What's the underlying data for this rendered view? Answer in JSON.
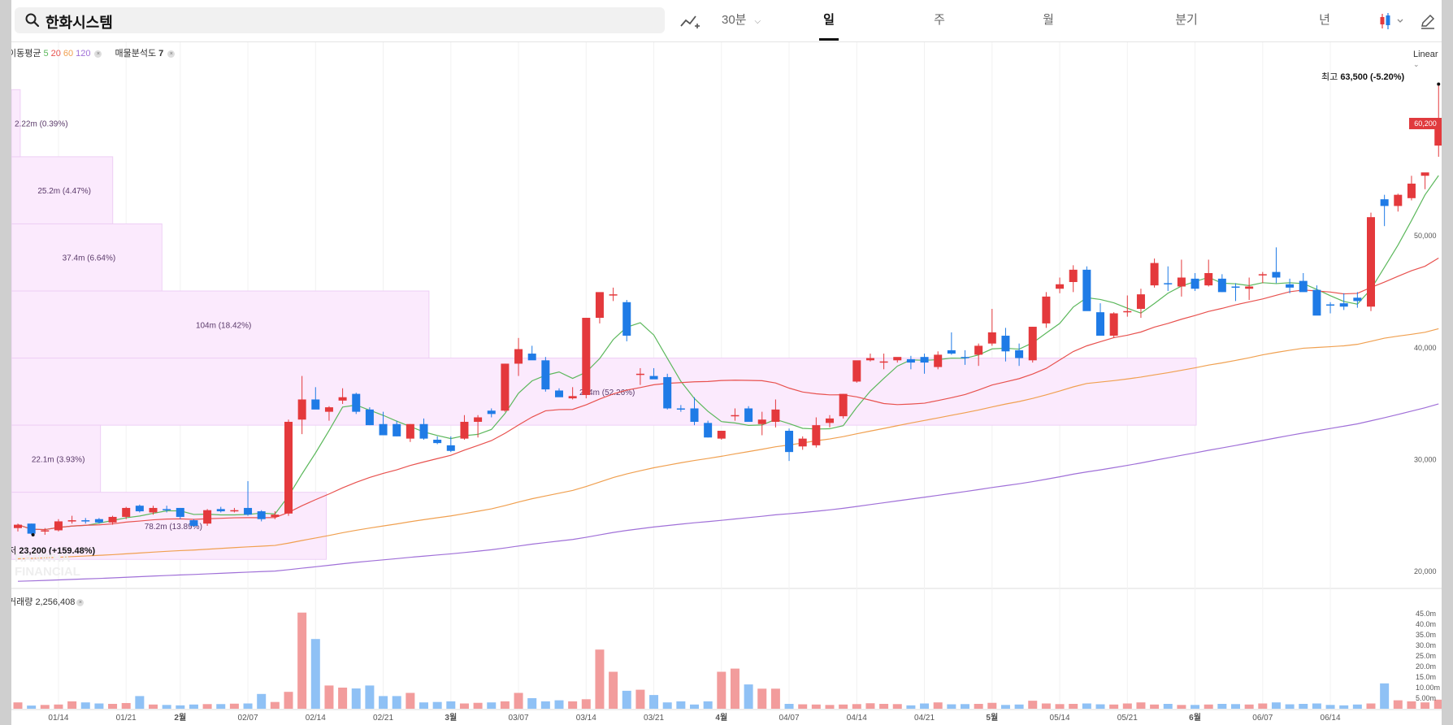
{
  "search": {
    "query": "한화시스템",
    "icon": "search-icon"
  },
  "toolbar": {
    "draw_icon": "draw-line-icon",
    "interval": "30분",
    "tabs": [
      {
        "label": "일",
        "active": true
      },
      {
        "label": "주",
        "active": false
      },
      {
        "label": "월",
        "active": false
      },
      {
        "label": "분기",
        "active": false
      },
      {
        "label": "년",
        "active": false
      }
    ],
    "chart_type_icon": "candlestick-icon",
    "pen_icon": "pencil-icon"
  },
  "legend": {
    "ma_label": "이동평균",
    "ma_periods": [
      "5",
      "20",
      "60",
      "120"
    ],
    "ma_colors": [
      "#5cb85c",
      "#e8524f",
      "#f0a050",
      "#a070d8"
    ],
    "profile_label": "매물분석도",
    "profile_count": "7"
  },
  "scale_label": "Linear",
  "current_price_tag": "60,200",
  "high": {
    "prefix": "최고",
    "value": "63,500",
    "change": "(-5.20%)"
  },
  "low": {
    "prefix": "최저",
    "value": "23,200",
    "change": "(+159.48%)"
  },
  "watermark": [
    "HANWHA",
    "FINANCIAL"
  ],
  "volume_legend": {
    "label": "거래량",
    "value": "2,256,408"
  },
  "colors": {
    "up": "#e4393c",
    "down": "#1f7be6",
    "up_vol": "#f29c9c",
    "down_vol": "#8fc1f5",
    "profile": "#fbeafd",
    "profile_border": "#eecff5"
  },
  "chart_data": {
    "type": "candlestick",
    "price_axis": {
      "ticks": [
        20000,
        30000,
        40000,
        50000
      ],
      "tick_labels": [
        "20,000",
        "30,000",
        "40,000",
        "50,000"
      ],
      "range": [
        17000,
        63500
      ]
    },
    "volume_axis": {
      "ticks": [
        5,
        10,
        15,
        20,
        25,
        30,
        35,
        40,
        45
      ],
      "tick_labels": [
        "5.00m",
        "10.00m",
        "15.0m",
        "20.0m",
        "25.0m",
        "30.0m",
        "35.0m",
        "40.0m",
        "45.0m"
      ],
      "range": [
        0,
        47
      ]
    },
    "x_ticks": [
      "01/14",
      "01/21",
      "2월",
      "02/07",
      "02/14",
      "02/21",
      "3월",
      "03/07",
      "03/14",
      "03/21",
      "4월",
      "04/07",
      "04/14",
      "04/21",
      "5월",
      "05/14",
      "05/21",
      "6월",
      "06/07",
      "06/14"
    ],
    "x_tick_index": [
      3,
      8,
      12,
      17,
      22,
      27,
      32,
      37,
      42,
      47,
      52,
      57,
      62,
      67,
      72,
      77,
      82,
      87,
      92,
      97
    ],
    "volume_profile": [
      {
        "label": "294m (52.26%)",
        "low": 33000,
        "high": 39000,
        "pct": 52.26
      },
      {
        "label": "104m (18.42%)",
        "low": 39000,
        "high": 45000,
        "pct": 18.42
      },
      {
        "label": "37.4m (6.64%)",
        "low": 45000,
        "high": 51000,
        "pct": 6.64
      },
      {
        "label": "25.2m (4.47%)",
        "low": 51000,
        "high": 57000,
        "pct": 4.47
      },
      {
        "label": "2.22m (0.39%)",
        "low": 57000,
        "high": 63000,
        "pct": 0.39
      },
      {
        "label": "22.1m (3.93%)",
        "low": 27000,
        "high": 33000,
        "pct": 3.93
      },
      {
        "label": "78.2m (13.89%)",
        "low": 21000,
        "high": 27000,
        "pct": 13.89
      }
    ],
    "candles": [
      [
        23800,
        24200,
        23500,
        24100
      ],
      [
        24200,
        24200,
        23200,
        23300
      ],
      [
        23500,
        23800,
        23200,
        23600
      ],
      [
        23600,
        24600,
        23500,
        24400
      ],
      [
        24500,
        24900,
        24200,
        24500
      ],
      [
        24500,
        24700,
        24200,
        24400
      ],
      [
        24600,
        24700,
        24200,
        24300
      ],
      [
        24300,
        24900,
        24100,
        24800
      ],
      [
        24800,
        25700,
        24600,
        25600
      ],
      [
        25800,
        25900,
        25200,
        25300
      ],
      [
        25200,
        25800,
        25000,
        25600
      ],
      [
        25500,
        25800,
        25200,
        25400
      ],
      [
        25600,
        25600,
        24600,
        24800
      ],
      [
        24500,
        24600,
        23900,
        24000
      ],
      [
        24200,
        25500,
        24000,
        25400
      ],
      [
        25500,
        25700,
        25200,
        25300
      ],
      [
        25400,
        25600,
        25200,
        25400
      ],
      [
        25600,
        28000,
        24900,
        25000
      ],
      [
        25300,
        25400,
        24400,
        24600
      ],
      [
        24800,
        25300,
        24600,
        25000
      ],
      [
        25100,
        33500,
        24900,
        33300
      ],
      [
        33500,
        37400,
        32200,
        35300
      ],
      [
        35300,
        36400,
        34700,
        34400
      ],
      [
        34200,
        34700,
        33400,
        34600
      ],
      [
        35200,
        36300,
        34900,
        35500
      ],
      [
        35800,
        35900,
        34000,
        34200
      ],
      [
        34400,
        34600,
        33000,
        33000
      ],
      [
        33100,
        34200,
        32300,
        32100
      ],
      [
        33100,
        33400,
        32000,
        32000
      ],
      [
        31800,
        33100,
        31500,
        33100
      ],
      [
        33100,
        33600,
        31700,
        31800
      ],
      [
        31700,
        32000,
        31300,
        31400
      ],
      [
        31200,
        32000,
        30600,
        30700
      ],
      [
        31800,
        33900,
        31700,
        33300
      ],
      [
        33300,
        33900,
        31900,
        33700
      ],
      [
        34300,
        34500,
        33700,
        34000
      ],
      [
        34300,
        38500,
        34200,
        38500
      ],
      [
        38500,
        40800,
        37400,
        39800
      ],
      [
        39400,
        40100,
        38900,
        38800
      ],
      [
        38800,
        39100,
        36000,
        36200
      ],
      [
        36100,
        36300,
        35600,
        35500
      ],
      [
        35400,
        36400,
        35300,
        35600
      ],
      [
        35700,
        42600,
        35400,
        42600
      ],
      [
        42600,
        44800,
        42100,
        44900
      ],
      [
        44700,
        45300,
        44100,
        44700
      ],
      [
        44000,
        44200,
        40500,
        41000
      ],
      [
        37500,
        38100,
        36600,
        37600
      ],
      [
        37400,
        38100,
        37300,
        37100
      ],
      [
        37300,
        37600,
        34400,
        34500
      ],
      [
        34500,
        34800,
        34200,
        34400
      ],
      [
        34500,
        35500,
        33000,
        33300
      ],
      [
        33200,
        33400,
        31900,
        31900
      ],
      [
        31800,
        32200,
        31700,
        32500
      ],
      [
        33800,
        34500,
        33400,
        33900
      ],
      [
        34500,
        34700,
        33500,
        33300
      ],
      [
        33100,
        34200,
        32100,
        33500
      ],
      [
        33300,
        35300,
        32800,
        34400
      ],
      [
        32500,
        32700,
        29800,
        30600
      ],
      [
        31100,
        32000,
        30800,
        31800
      ],
      [
        31200,
        33700,
        31000,
        33000
      ],
      [
        33200,
        33900,
        32800,
        33600
      ],
      [
        33800,
        35800,
        33600,
        35800
      ],
      [
        36900,
        38700,
        36800,
        38800
      ],
      [
        38800,
        39400,
        38700,
        39000
      ],
      [
        38700,
        39400,
        38000,
        38700
      ],
      [
        38800,
        39000,
        38600,
        39100
      ],
      [
        38900,
        39200,
        38000,
        38600
      ],
      [
        39100,
        39400,
        37600,
        38600
      ],
      [
        38200,
        39600,
        38000,
        39300
      ],
      [
        39700,
        41300,
        39300,
        39400
      ],
      [
        39100,
        39700,
        38400,
        39000
      ],
      [
        39300,
        40300,
        38300,
        40100
      ],
      [
        40300,
        43400,
        40100,
        41300
      ],
      [
        41000,
        41700,
        38700,
        39600
      ],
      [
        39700,
        40300,
        38300,
        39000
      ],
      [
        38800,
        41800,
        38600,
        41800
      ],
      [
        42100,
        44900,
        41700,
        44500
      ],
      [
        45200,
        46200,
        44800,
        45600
      ],
      [
        45800,
        47300,
        44900,
        46900
      ],
      [
        46900,
        47200,
        43300,
        43200
      ],
      [
        43100,
        43900,
        42700,
        41000
      ],
      [
        41000,
        43100,
        40800,
        43000
      ],
      [
        43100,
        44600,
        42700,
        43200
      ],
      [
        43400,
        45200,
        42600,
        44700
      ],
      [
        45500,
        47900,
        45300,
        47500
      ],
      [
        45700,
        47200,
        45000,
        45600
      ],
      [
        45400,
        47800,
        44500,
        46200
      ],
      [
        46100,
        46600,
        45000,
        45200
      ],
      [
        45500,
        47800,
        45400,
        46600
      ],
      [
        46100,
        46500,
        44900,
        44900
      ],
      [
        45400,
        45700,
        44100,
        45300
      ],
      [
        45200,
        46200,
        44200,
        45400
      ],
      [
        46400,
        46700,
        45700,
        46500
      ],
      [
        46700,
        48900,
        45700,
        46200
      ],
      [
        45600,
        46100,
        44800,
        45300
      ],
      [
        45900,
        46600,
        45000,
        44900
      ],
      [
        45100,
        45500,
        43000,
        42800
      ],
      [
        43800,
        44000,
        43000,
        43700
      ],
      [
        43900,
        44800,
        43300,
        43600
      ],
      [
        44400,
        44900,
        43500,
        44100
      ]
    ],
    "candles_tail": [
      [
        43600,
        52000,
        43200,
        51600
      ],
      [
        53200,
        53600,
        50800,
        52600
      ],
      [
        52600,
        53700,
        52100,
        53600
      ],
      [
        53300,
        55300,
        53100,
        54600
      ],
      [
        55300,
        55400,
        54100,
        55600
      ],
      [
        58000,
        63500,
        57000,
        60200
      ]
    ],
    "volume_m": [
      3,
      1.5,
      1.8,
      2,
      3.5,
      3,
      2.5,
      2.3,
      2.7,
      6,
      2,
      1.8,
      1.6,
      2,
      2.2,
      2.2,
      2.4,
      2.5,
      7,
      3.2,
      8,
      45.5,
      33,
      11,
      10,
      9.6,
      11,
      6,
      6,
      7.5,
      3,
      3.2,
      3.5,
      2.5,
      2.8,
      3,
      3.5,
      7.5,
      5,
      3.5,
      4,
      3.5,
      4.5,
      28,
      17.5,
      8.5,
      9,
      6.5,
      3,
      3.5,
      2,
      3.5,
      17.5,
      19,
      11.5,
      9.5,
      9.5,
      2.3,
      2.1,
      2,
      1.8,
      2,
      2.2,
      2.6,
      2.3,
      2.2,
      1.6,
      2.5,
      3,
      2.1,
      2.2,
      2.3,
      2.8,
      1.8,
      2,
      3.8,
      2.5,
      2.2,
      2.3,
      2.5,
      2.1,
      2,
      2.5,
      3,
      2,
      2.3,
      1.8,
      1.8,
      2,
      2.3,
      2.2,
      2,
      2.5,
      3,
      2.1,
      2.3,
      2.5,
      1.8,
      1.6,
      2,
      2.5,
      12,
      4,
      3.5,
      3,
      4.3,
      2.3
    ]
  }
}
